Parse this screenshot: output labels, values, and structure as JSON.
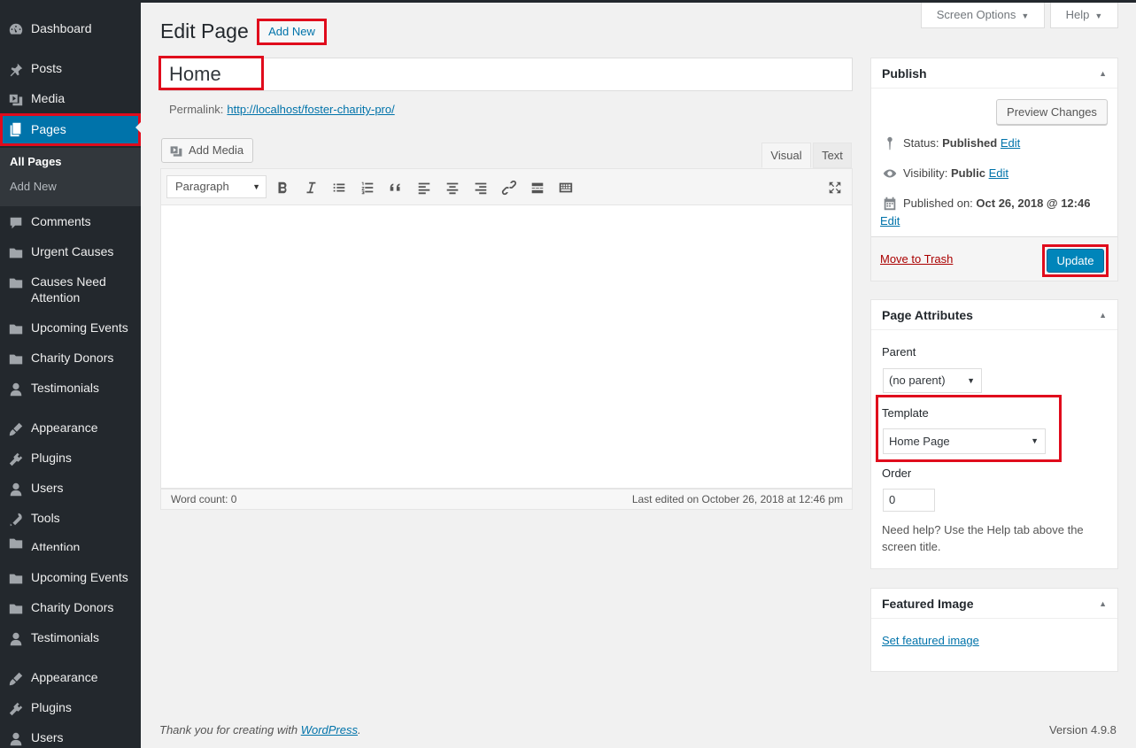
{
  "sidebar": {
    "items": [
      {
        "label": "Dashboard",
        "icon": "dashboard-icon"
      },
      {
        "label": "Posts",
        "icon": "pin-icon"
      },
      {
        "label": "Media",
        "icon": "media-icon"
      },
      {
        "label": "Pages",
        "icon": "pages-icon"
      },
      {
        "label": "Comments",
        "icon": "comment-icon"
      },
      {
        "label": "Urgent Causes",
        "icon": "folder-icon"
      },
      {
        "label": "Causes Need Attention",
        "icon": "folder-icon"
      },
      {
        "label": "Upcoming Events",
        "icon": "folder-icon"
      },
      {
        "label": "Charity Donors",
        "icon": "folder-icon"
      },
      {
        "label": "Testimonials",
        "icon": "user-icon"
      },
      {
        "label": "Appearance",
        "icon": "brush-icon"
      },
      {
        "label": "Plugins",
        "icon": "plugin-icon"
      },
      {
        "label": "Users",
        "icon": "user-icon"
      },
      {
        "label": "Tools",
        "icon": "wrench-icon"
      },
      {
        "label": "Attention",
        "icon": "folder-icon"
      },
      {
        "label": "Upcoming Events",
        "icon": "folder-icon"
      },
      {
        "label": "Charity Donors",
        "icon": "folder-icon"
      },
      {
        "label": "Testimonials",
        "icon": "user-icon"
      },
      {
        "label": "Appearance",
        "icon": "brush-icon"
      },
      {
        "label": "Plugins",
        "icon": "plugin-icon"
      },
      {
        "label": "Users",
        "icon": "user-icon"
      }
    ],
    "submenu": {
      "all_pages": "All Pages",
      "add_new": "Add New"
    }
  },
  "top": {
    "screen_options": "Screen Options",
    "help": "Help"
  },
  "header": {
    "title": "Edit Page",
    "add_new": "Add New"
  },
  "editor": {
    "title_value": "Home",
    "permalink_label": "Permalink:",
    "permalink_url": "http://localhost/foster-charity-pro/",
    "add_media": "Add Media",
    "tab_visual": "Visual",
    "tab_text": "Text",
    "format_select": "Paragraph",
    "word_count": "Word count: 0",
    "last_edited": "Last edited on October 26, 2018 at 12:46 pm"
  },
  "publish": {
    "heading": "Publish",
    "preview": "Preview Changes",
    "status_label": "Status:",
    "status_value": "Published",
    "visibility_label": "Visibility:",
    "visibility_value": "Public",
    "published_label": "Published on:",
    "published_value": "Oct 26, 2018 @ 12:46",
    "edit": "Edit",
    "trash": "Move to Trash",
    "update": "Update"
  },
  "page_attributes": {
    "heading": "Page Attributes",
    "parent_label": "Parent",
    "parent_value": "(no parent)",
    "template_label": "Template",
    "template_value": "Home Page",
    "order_label": "Order",
    "order_value": "0",
    "help": "Need help? Use the Help tab above the screen title."
  },
  "featured": {
    "heading": "Featured Image",
    "link": "Set featured image"
  },
  "footer": {
    "thanks_prefix": "Thank you for creating with",
    "wp_link": "WordPress",
    "thanks_suffix": ".",
    "version": "Version 4.9.8"
  },
  "colors": {
    "admin_bg": "#23282d",
    "accent": "#0073aa",
    "highlight": "#e00b1c"
  }
}
